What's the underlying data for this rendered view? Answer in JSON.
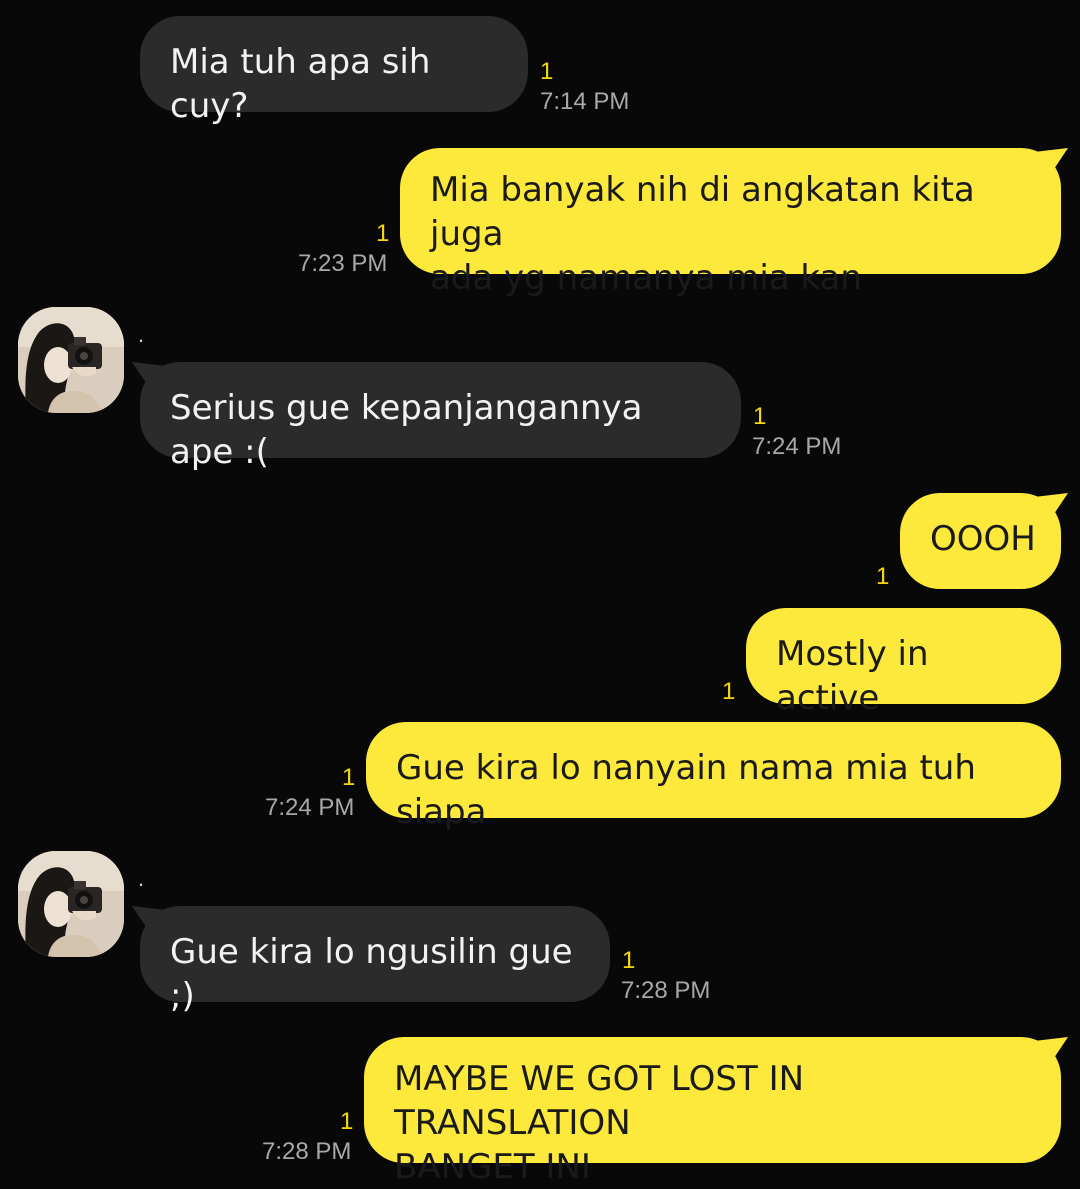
{
  "chat": {
    "messages": [
      {
        "direction": "incoming",
        "text": "Mia tuh apa sih cuy?",
        "unread": "1",
        "time": "7:14 PM"
      },
      {
        "direction": "outgoing",
        "text": "Mia banyak nih di angkatan kita juga\nada yg namanya mia kan",
        "unread": "1",
        "time": "7:23 PM"
      },
      {
        "direction": "incoming",
        "sender_name": ".",
        "text": "Serius gue kepanjangannya ape :(",
        "unread": "1",
        "time": "7:24 PM"
      },
      {
        "direction": "outgoing",
        "text": "OOOH",
        "unread": "1",
        "time": ""
      },
      {
        "direction": "outgoing",
        "text": "Mostly in active",
        "unread": "1",
        "time": ""
      },
      {
        "direction": "outgoing",
        "text": "Gue kira lo nanyain nama mia tuh siapa",
        "unread": "1",
        "time": "7:24 PM"
      },
      {
        "direction": "incoming",
        "sender_name": ".",
        "text": "Gue kira lo ngusilin gue ;)",
        "unread": "1",
        "time": "7:28 PM"
      },
      {
        "direction": "outgoing",
        "text": "MAYBE WE GOT LOST IN TRANSLATION\nBANGET INI",
        "unread": "1",
        "time": "7:28 PM"
      }
    ]
  },
  "colors": {
    "background": "#080808",
    "incoming_bubble": "#2b2b2b",
    "outgoing_bubble": "#fde93c",
    "unread_count": "#f5d90a",
    "timestamp": "#a8a8a8"
  }
}
